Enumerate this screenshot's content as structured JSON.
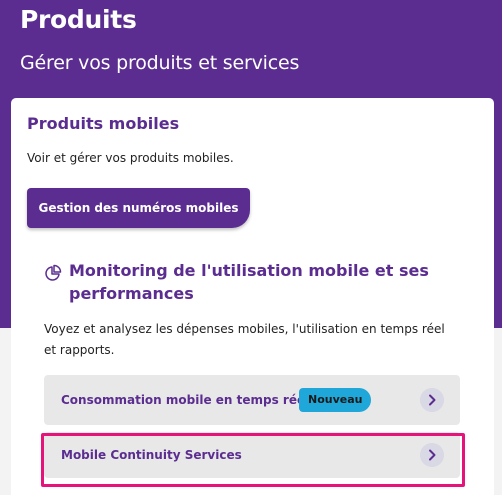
{
  "header": {
    "title": "Produits",
    "subtitle": "Gérer vos produits et services"
  },
  "card": {
    "title": "Produits mobiles",
    "description": "Voir et gérer vos produits mobiles.",
    "primary_button": "Gestion des numéros mobiles"
  },
  "section": {
    "icon": "pie-chart-icon",
    "title": "Monitoring de l'utilisation mobile et ses performances",
    "description": "Voyez et analysez les dépenses mobiles, l'utilisation en temps réel et rapports."
  },
  "links": [
    {
      "label": "Consommation mobile en temps réel",
      "badge": "Nouveau",
      "icon": "chevron-right-icon"
    },
    {
      "label": "Mobile Continuity Services",
      "icon": "chevron-right-icon"
    }
  ],
  "colors": {
    "brand_purple": "#5b2d90",
    "badge_blue": "#1ea7d8",
    "highlight_pink": "#e6137b"
  }
}
